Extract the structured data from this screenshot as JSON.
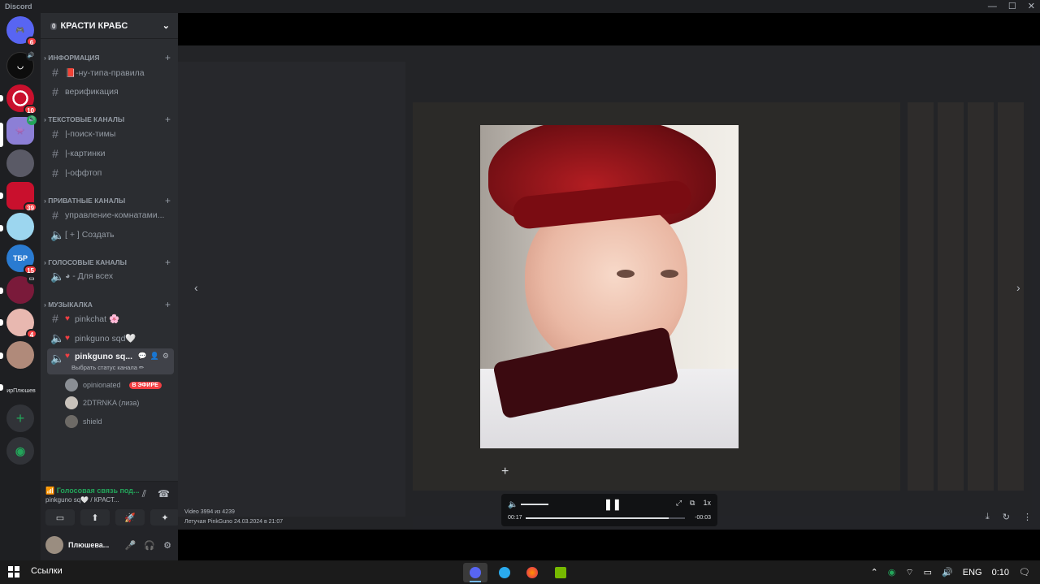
{
  "window": {
    "title": "Discord",
    "controls": [
      "—",
      "☐",
      "✕"
    ]
  },
  "rail": {
    "servers": [
      {
        "name": "discord-home",
        "badge": "6"
      },
      {
        "name": "server-2",
        "badge": ""
      },
      {
        "name": "server-3",
        "badge": "10"
      },
      {
        "name": "server-4",
        "badge": ""
      },
      {
        "name": "server-5",
        "badge": ""
      },
      {
        "name": "server-6",
        "badge": "39"
      },
      {
        "name": "server-7",
        "badge": ""
      },
      {
        "name": "server-8",
        "badge": "15"
      },
      {
        "name": "server-9",
        "badge": ""
      },
      {
        "name": "server-10",
        "badge": "4"
      },
      {
        "name": "server-11",
        "badge": ""
      }
    ],
    "folder_label": "ирПлюшев"
  },
  "guild": {
    "name": "КРАСТИ КРАБС",
    "boost": "0"
  },
  "categories": [
    {
      "label": "ИНФОРМАЦИЯ"
    },
    {
      "label": "ТЕКСТОВЫЕ КАНАЛЫ"
    },
    {
      "label": "ПРИВАТНЫЕ КАНАЛЫ"
    },
    {
      "label": "ГОЛОСОВЫЕ КАНАЛЫ"
    },
    {
      "label": "МУЗЫКАЛКА"
    }
  ],
  "channels": {
    "rules": "📕-ну-типа-правила",
    "verify": "верификация",
    "search": "|-поиск-тимы",
    "pics": "|-картинки",
    "offtop": "|-оффтоп",
    "manage": "управление-комнатами...",
    "create": "[ + ] Создать",
    "for_all": "◕ - Для всех",
    "pinkchat": "pinkchat 🌸",
    "sqd": "pinkguno sqd🤍",
    "sqd_active": "pinkguno sq...",
    "status_hint": "Выбрать статус канала ✏"
  },
  "voice_users": [
    {
      "name": "opinionated",
      "live": "В ЭФИРЕ"
    },
    {
      "name": "2DTRNKA (лиза)",
      "live": ""
    },
    {
      "name": "shield",
      "live": ""
    }
  ],
  "voice_panel": {
    "status": "Голосовая связь под...",
    "where": "pinkguno sq🤍 / КРАСТ..."
  },
  "user": {
    "name": "Плюшева..."
  },
  "viewer": {
    "time_current": "00:17",
    "time_remaining": "-00:03",
    "progress": 0.9,
    "meta_line1": "Video 3994 из 4239",
    "meta_line2": "Летучая PinkGuno   24.03.2024 в 21:07"
  },
  "taskbar": {
    "search_label": "Ссылки",
    "lang": "ENG",
    "time": "0:10"
  }
}
